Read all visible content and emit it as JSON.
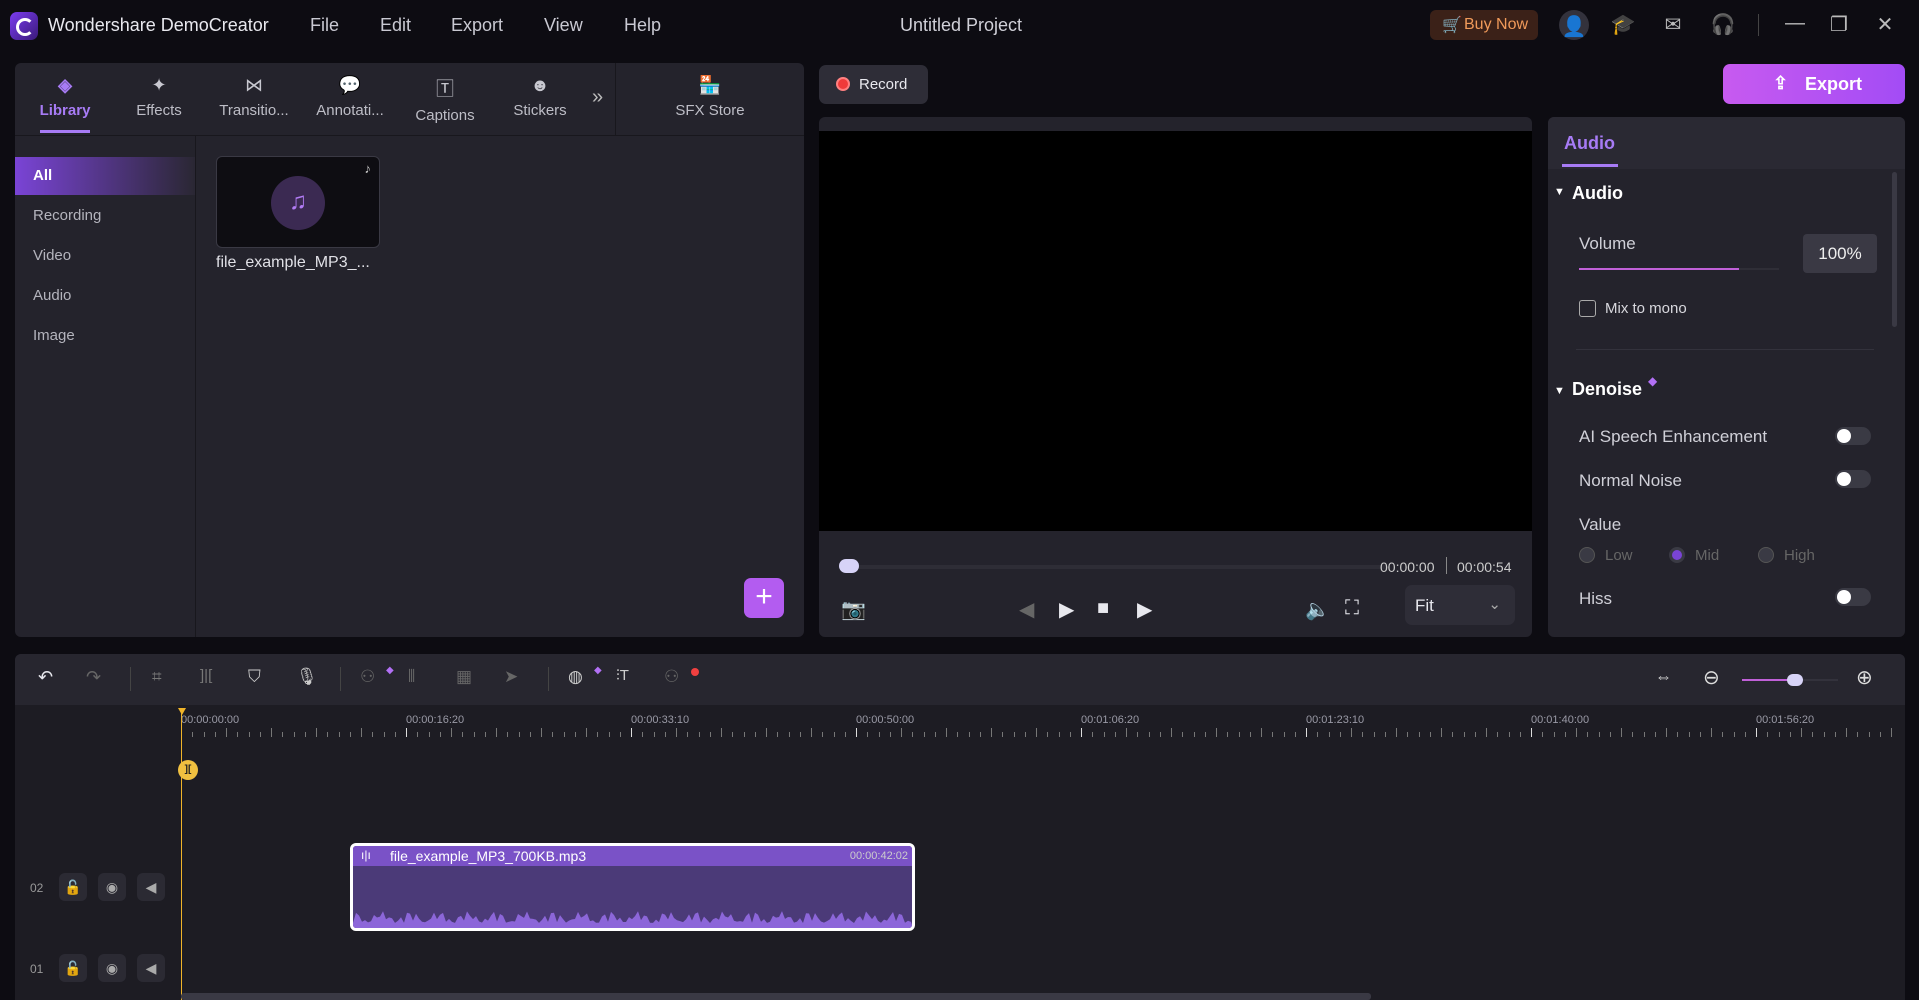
{
  "titlebar": {
    "app_name": "Wondershare DemoCreator",
    "menu": [
      "File",
      "Edit",
      "Export",
      "View",
      "Help"
    ],
    "project_title": "Untitled Project",
    "buy_now": "Buy Now"
  },
  "library": {
    "tabs": [
      "Library",
      "Effects",
      "Transitio...",
      "Annotati...",
      "Captions",
      "Stickers"
    ],
    "sfx_store": "SFX Store",
    "sidebar": [
      "All",
      "Recording",
      "Video",
      "Audio",
      "Image"
    ],
    "media": [
      {
        "name": "file_example_MP3_..."
      }
    ]
  },
  "preview": {
    "record_label": "Record",
    "current_time": "00:00:00",
    "total_time": "00:00:54",
    "fit_label": "Fit",
    "progress": 0
  },
  "export_label": "Export",
  "properties": {
    "tab": "Audio",
    "audio_section": "Audio",
    "volume_label": "Volume",
    "volume_value": "100%",
    "volume_level": 0.8,
    "mix_to_mono": "Mix to mono",
    "mix_to_mono_checked": false,
    "denoise_section": "Denoise",
    "ai_speech": "AI Speech Enhancement",
    "normal_noise": "Normal Noise",
    "value_label": "Value",
    "value_options": [
      "Low",
      "Mid",
      "High"
    ],
    "value_selected": "Mid",
    "hiss": "Hiss"
  },
  "timeline": {
    "ruler": [
      "00:00:00:00",
      "00:00:16:20",
      "00:00:33:10",
      "00:00:50:00",
      "00:01:06:20",
      "00:01:23:10",
      "00:01:40:00",
      "00:01:56:20"
    ],
    "tracks": [
      "02",
      "01"
    ],
    "clip": {
      "name": "file_example_MP3_700KB.mp3",
      "duration": "00:00:42:02"
    },
    "zoom_level": 0.55
  },
  "colors": {
    "accent": "#a77bf5",
    "clip": "#7a52c7",
    "export": "#c04ef0"
  }
}
